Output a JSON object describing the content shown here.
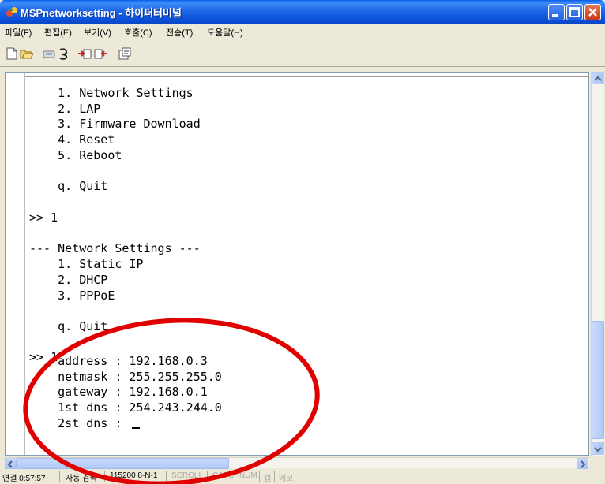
{
  "window": {
    "title": "MSPnetworksetting - 하이퍼터미널"
  },
  "menu": [
    {
      "label": "파일(F)"
    },
    {
      "label": "편집(E)"
    },
    {
      "label": "보기(V)"
    },
    {
      "label": "호출(C)"
    },
    {
      "label": "전송(T)"
    },
    {
      "label": "도움말(H)"
    }
  ],
  "toolbar": [
    {
      "icon": "new-file-icon"
    },
    {
      "icon": "open-folder-icon"
    },
    {
      "icon": "connect-icon"
    },
    {
      "icon": "disconnect-icon"
    },
    {
      "icon": "send-icon"
    },
    {
      "icon": "receive-icon"
    },
    {
      "icon": "properties-icon"
    }
  ],
  "terminal": {
    "lines": [
      "    1. Network Settings",
      "    2. LAP",
      "    3. Firmware Download",
      "    4. Reset",
      "    5. Reboot",
      "",
      "    q. Quit",
      "",
      ">> 1",
      "",
      "--- Network Settings ---",
      "    1. Static IP",
      "    2. DHCP",
      "    3. PPPoE",
      "",
      "    q. Quit",
      "",
      ">> 1",
      "",
      "    address : 192.168.0.3",
      "    netmask : 255.255.255.0",
      "    gateway : 192.168.0.1",
      "    1st dns : 254.243.244.0",
      "    2st dns : "
    ]
  },
  "status": {
    "connection": "연결 0:57:57",
    "detect": "자동 검색",
    "params": "115200 8-N-1",
    "scroll": "SCROLL",
    "caps": "CAPS",
    "num": "NUM",
    "capture": "캡",
    "echo": "에코"
  },
  "colors": {
    "annotation": "#e00000",
    "titlebar": "#0a4fd8"
  }
}
